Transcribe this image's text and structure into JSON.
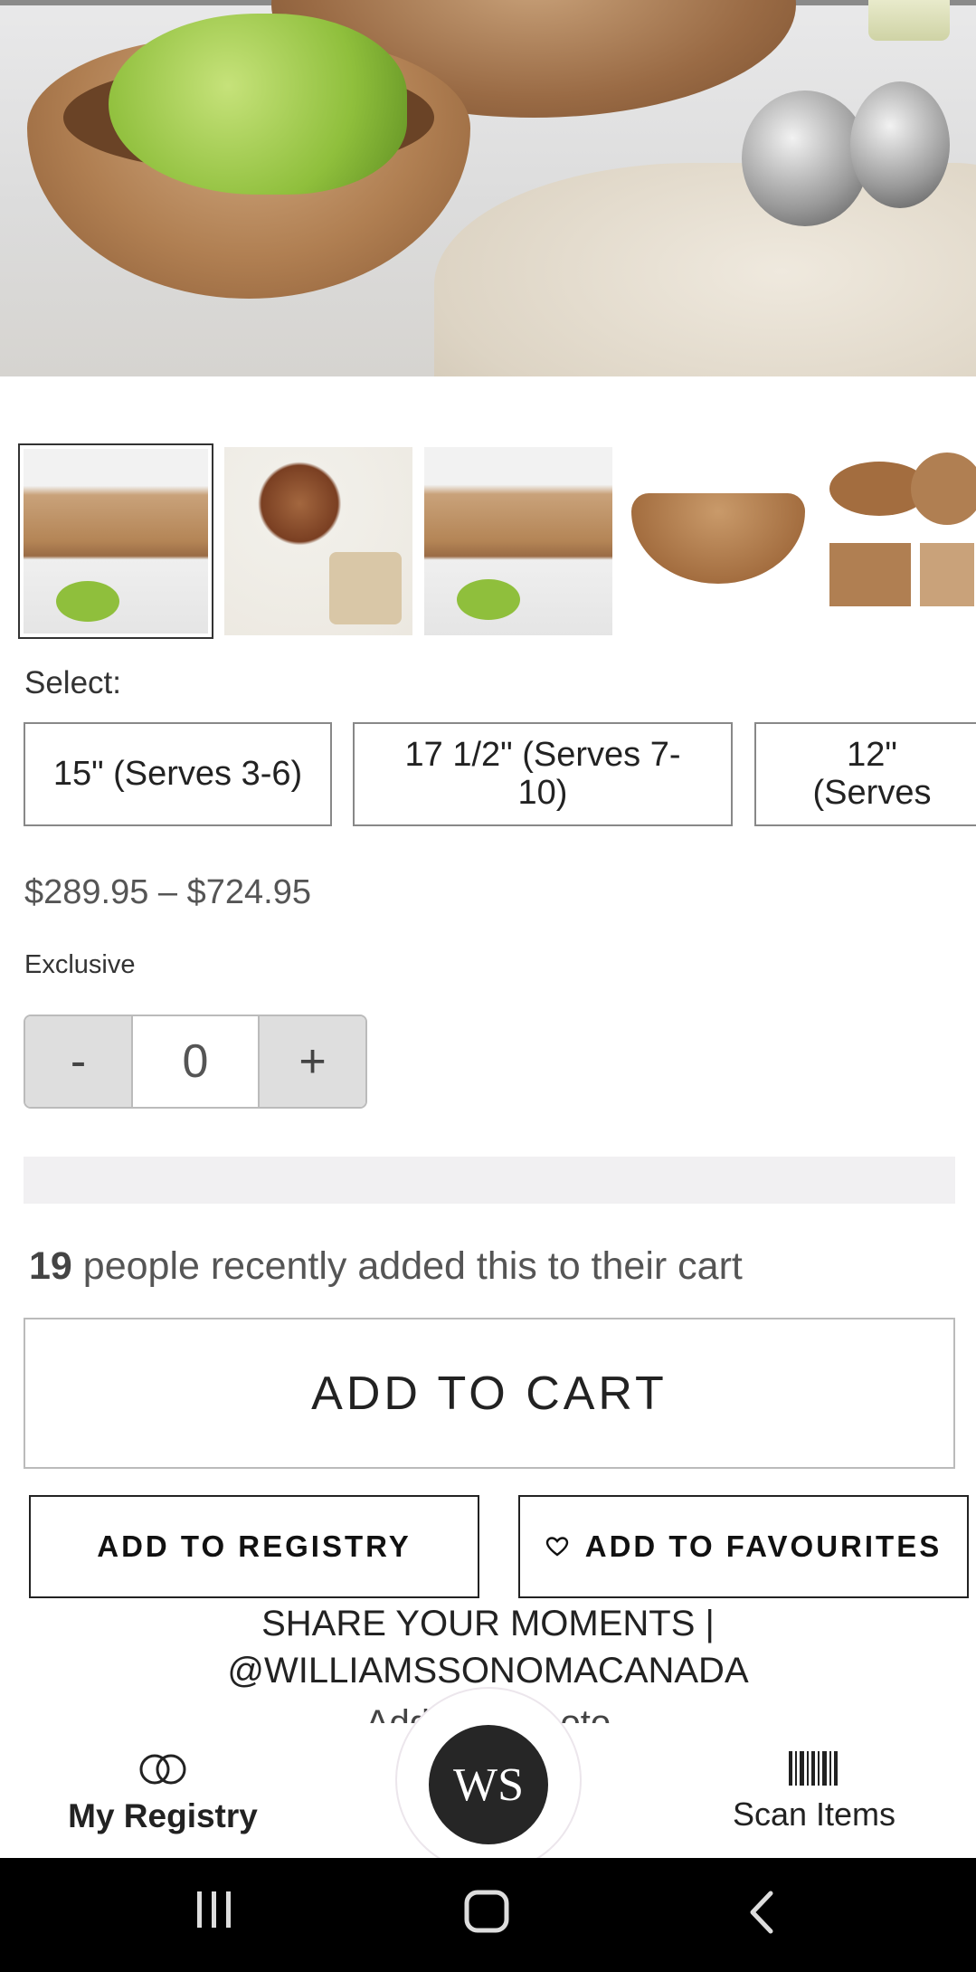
{
  "select": {
    "label": "Select:"
  },
  "sizes": [
    {
      "label": "15\" (Serves 3-6)"
    },
    {
      "label": "17 1/2\" (Serves 7-10)"
    },
    {
      "label": "12\" (Serves"
    }
  ],
  "price": {
    "range": "$289.95 – $724.95"
  },
  "badge": {
    "text": "Exclusive"
  },
  "quantity": {
    "minus": "-",
    "value": "0",
    "plus": "+"
  },
  "social_proof": {
    "count": "19",
    "text": " people recently added this to their cart"
  },
  "actions": {
    "add_to_cart": "ADD TO CART",
    "add_to_registry": "ADD TO REGISTRY",
    "add_to_favourites": "ADD TO FAVOURITES"
  },
  "share": {
    "line1": "SHARE YOUR MOMENTS |",
    "line2": "@WILLIAMSSONOMACANADA",
    "sub": "Add your photo"
  },
  "bottom_nav": {
    "registry": "My Registry",
    "logo": "WS",
    "scan": "Scan Items"
  },
  "icons": {
    "registry": "rings-icon",
    "scan": "barcode-icon",
    "favourite": "heart-outline-icon"
  }
}
